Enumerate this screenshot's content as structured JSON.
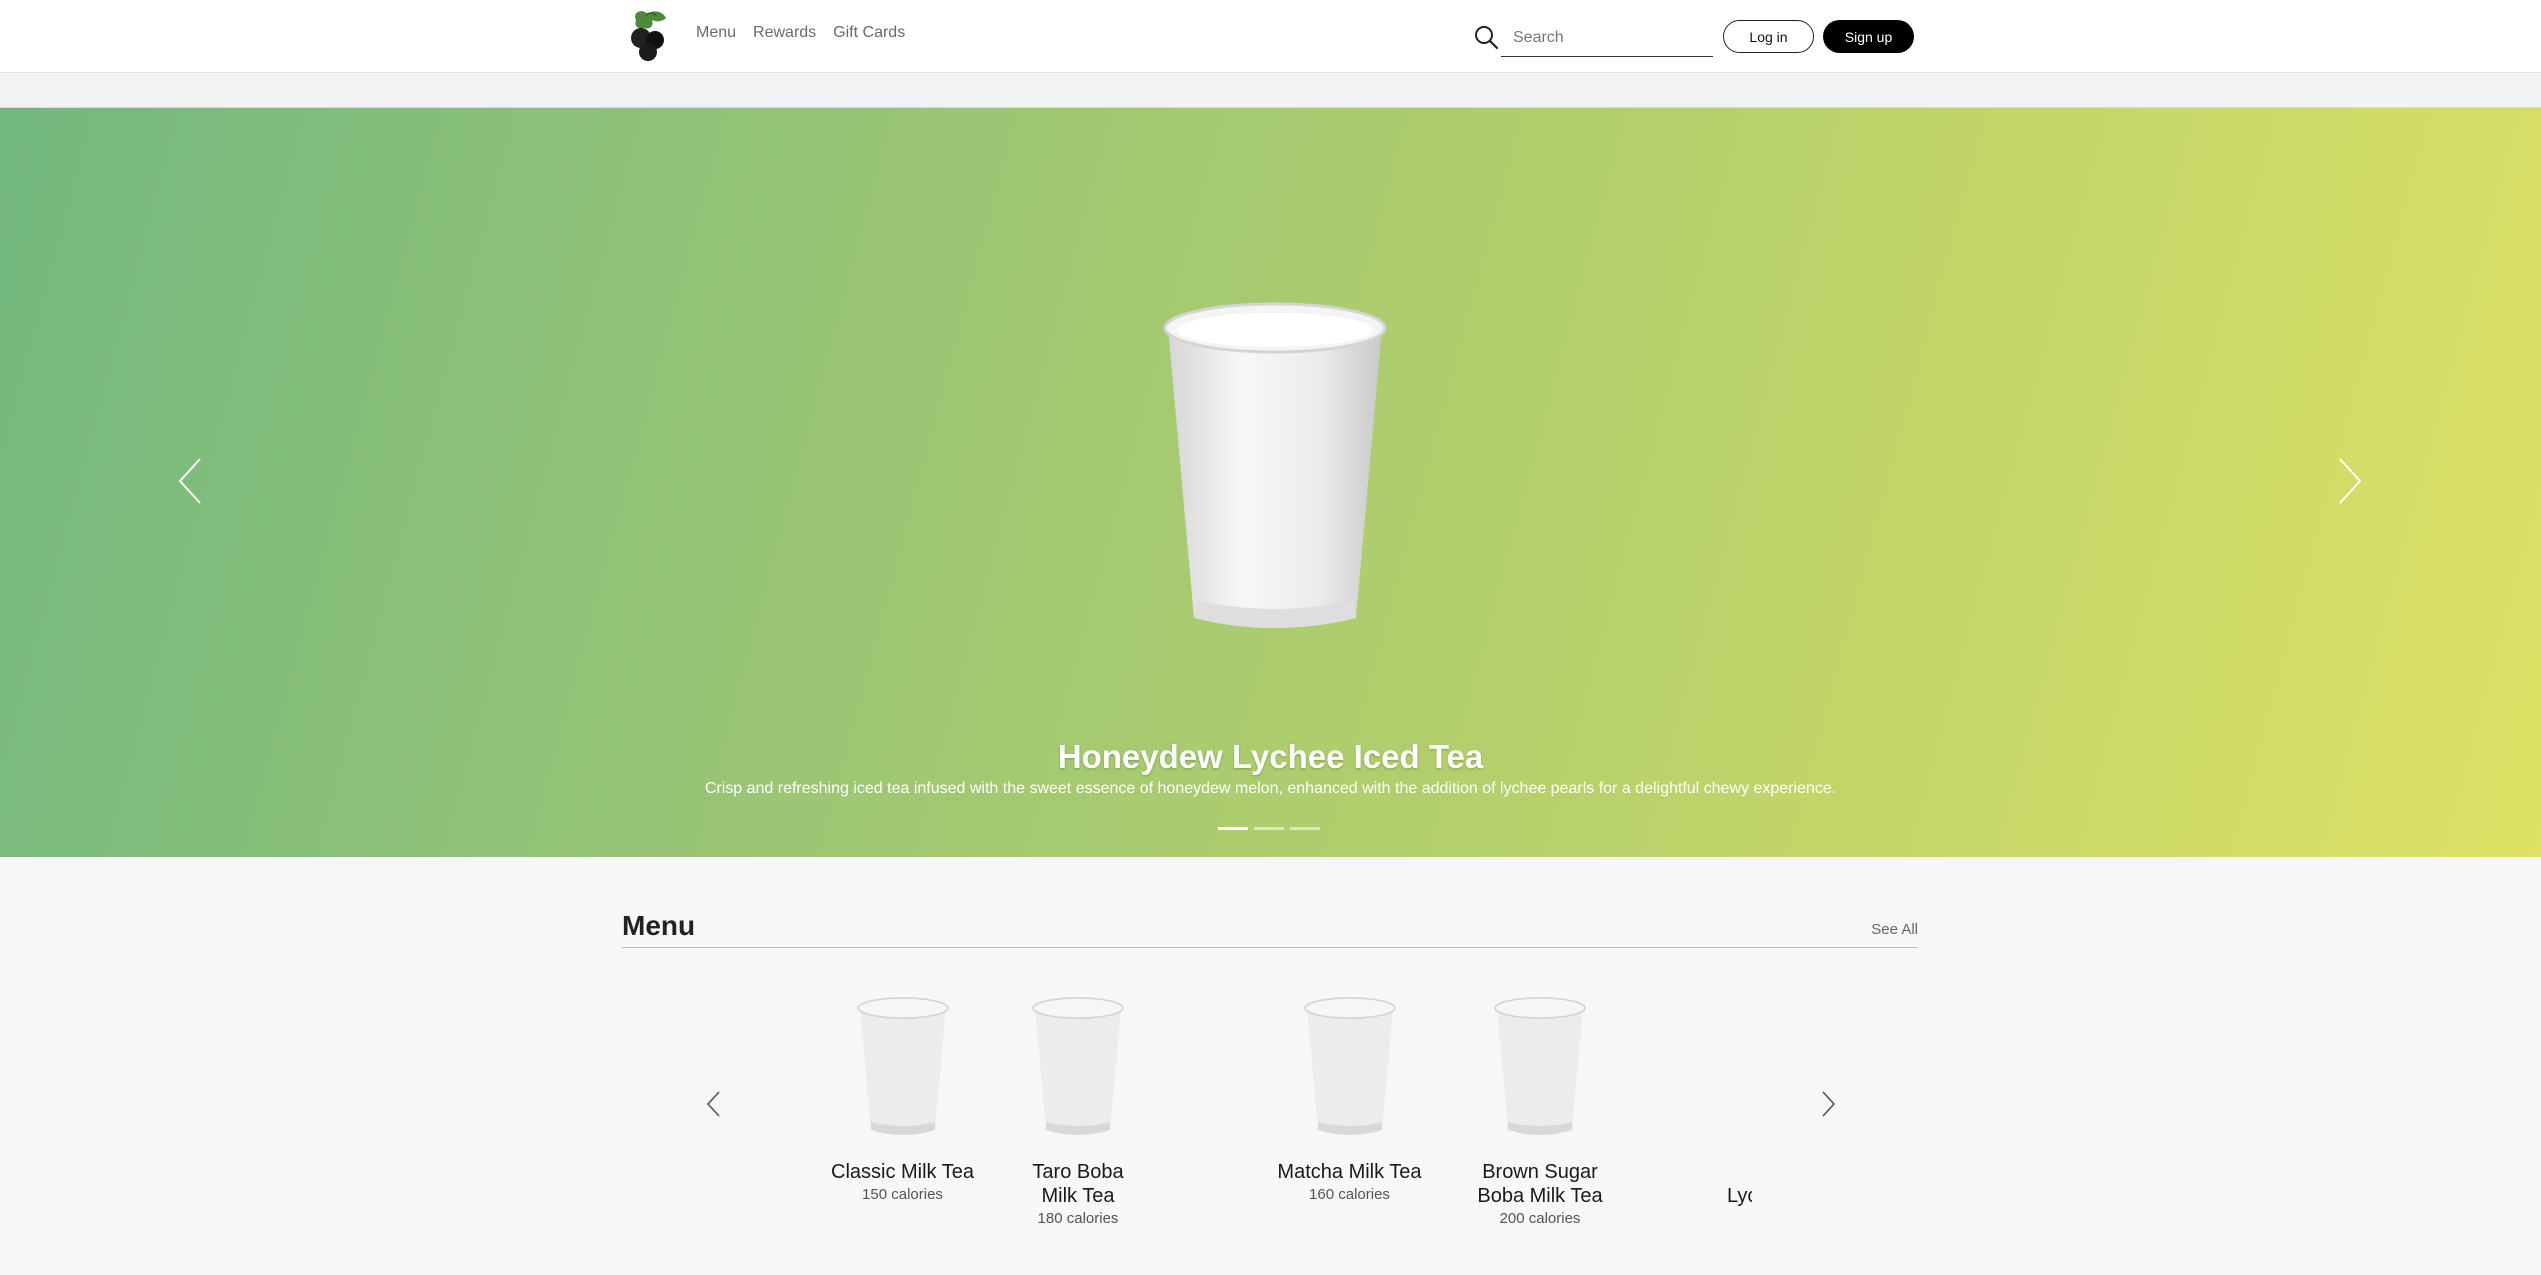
{
  "header": {
    "nav": [
      {
        "label": "Menu"
      },
      {
        "label": "Rewards"
      },
      {
        "label": "Gift Cards"
      }
    ],
    "search": {
      "placeholder": "Search"
    },
    "login_label": "Log in",
    "signup_label": "Sign up"
  },
  "hero": {
    "title": "Honeydew Lychee Iced Tea",
    "description": "Crisp and refreshing iced tea infused with the sweet essence of honeydew melon, enhanced with the addition of lychee pearls for a delightful chewy experience.",
    "slide_count": 3,
    "active_slide": 1,
    "gradient_colors": [
      "#72b880",
      "#96c476",
      "#b4cf6b",
      "#dde165"
    ]
  },
  "menu": {
    "title": "Menu",
    "see_all_label": "See All",
    "items": [
      {
        "name": "Classic Milk Tea",
        "calories": "150 calories"
      },
      {
        "name": "Taro Boba Milk Tea",
        "calories": "180 calories"
      },
      {
        "name": "Matcha Milk Tea",
        "calories": "160 calories"
      },
      {
        "name": "Brown Sugar Boba Milk Tea",
        "calories": "200 calories"
      },
      {
        "name": "Lyc",
        "calories": ""
      }
    ]
  },
  "colors": {
    "accent": "#000000",
    "logo_green": "#4f8a3c",
    "logo_dark": "#111111"
  }
}
